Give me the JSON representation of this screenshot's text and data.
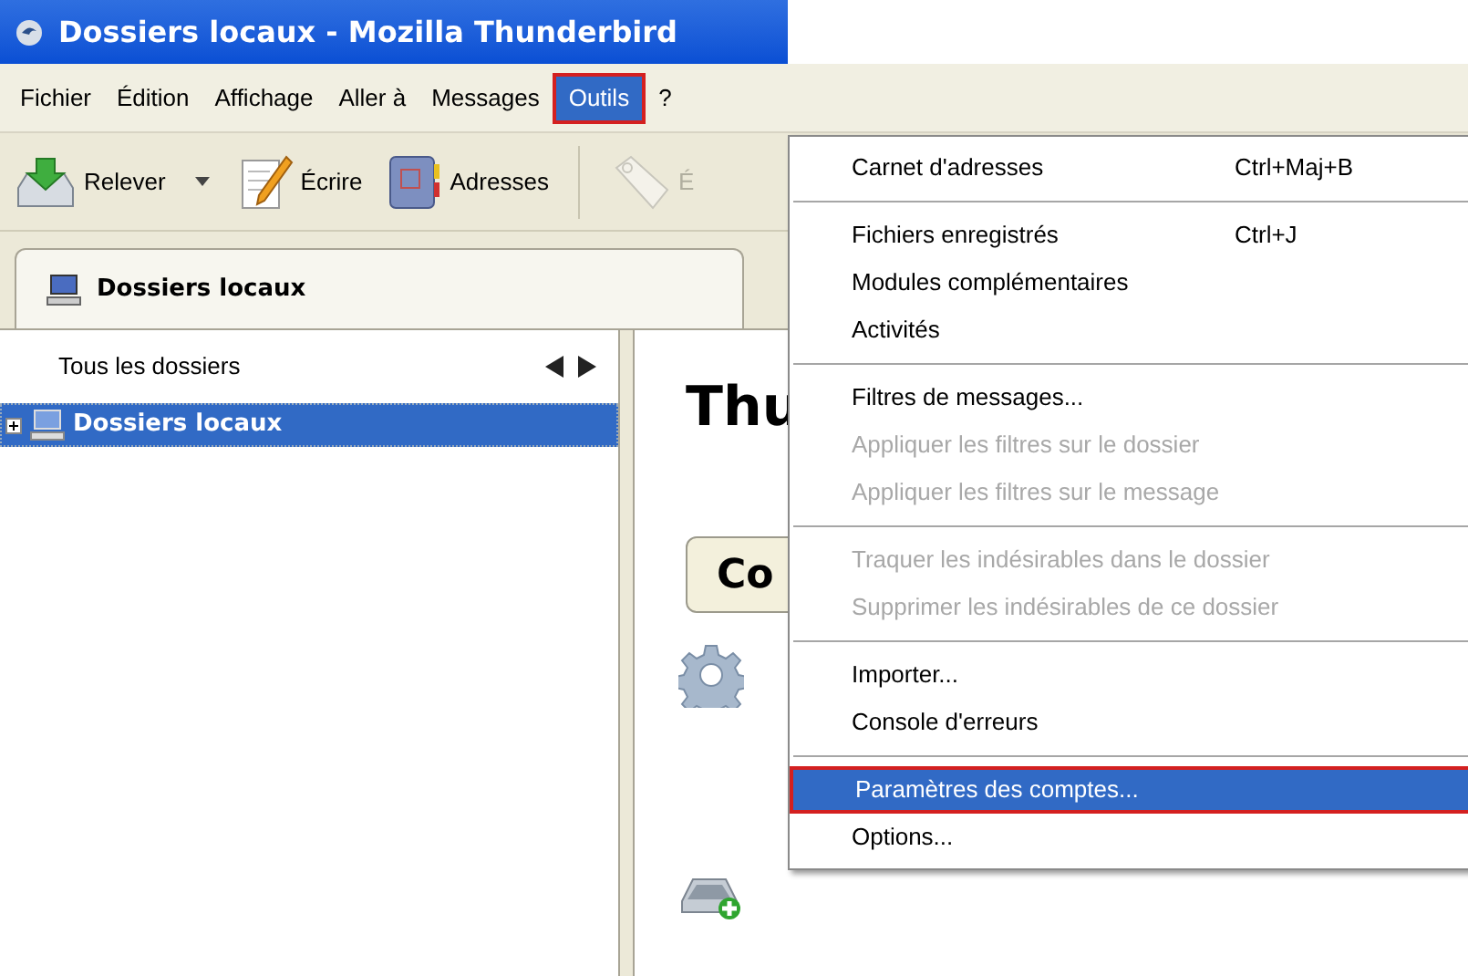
{
  "window": {
    "title": "Dossiers locaux - Mozilla Thunderbird"
  },
  "menubar": [
    {
      "label": "Fichier",
      "selected": false
    },
    {
      "label": "Édition",
      "selected": false
    },
    {
      "label": "Affichage",
      "selected": false
    },
    {
      "label": "Aller à",
      "selected": false
    },
    {
      "label": "Messages",
      "selected": false
    },
    {
      "label": "Outils",
      "selected": true
    },
    {
      "label": "?",
      "selected": false
    }
  ],
  "toolbar": [
    {
      "kind": "get",
      "label": "Relever",
      "dropdown": true,
      "disabled": false
    },
    {
      "kind": "write",
      "label": "Écrire",
      "dropdown": false,
      "disabled": false
    },
    {
      "kind": "book",
      "label": "Adresses",
      "dropdown": false,
      "disabled": false
    },
    {
      "kind": "tag",
      "label": "É",
      "dropdown": false,
      "disabled": true
    }
  ],
  "tabs": [
    {
      "label": "Dossiers locaux",
      "selected": true
    }
  ],
  "folder_pane": {
    "header": "Tous les dossiers",
    "items": [
      {
        "label": "Dossiers locaux",
        "selected": true,
        "expanded": false
      }
    ]
  },
  "content": {
    "heading": "Thu",
    "button": "Co"
  },
  "menu": [
    {
      "kind": "item",
      "label": "Carnet d'adresses",
      "shortcut": "Ctrl+Maj+B",
      "disabled": false,
      "selected": false
    },
    {
      "kind": "separator"
    },
    {
      "kind": "item",
      "label": "Fichiers enregistrés",
      "shortcut": "Ctrl+J",
      "disabled": false,
      "selected": false
    },
    {
      "kind": "item",
      "label": "Modules complémentaires",
      "disabled": false,
      "selected": false
    },
    {
      "kind": "item",
      "label": "Activités",
      "disabled": false,
      "selected": false
    },
    {
      "kind": "separator"
    },
    {
      "kind": "item",
      "label": "Filtres de messages...",
      "disabled": false,
      "selected": false
    },
    {
      "kind": "item",
      "label": "Appliquer les filtres sur le dossier",
      "disabled": true,
      "selected": false
    },
    {
      "kind": "item",
      "label": "Appliquer les filtres sur le message",
      "disabled": true,
      "selected": false
    },
    {
      "kind": "separator"
    },
    {
      "kind": "item",
      "label": "Traquer les indésirables dans le dossier",
      "disabled": true,
      "selected": false
    },
    {
      "kind": "item",
      "label": "Supprimer les indésirables de ce dossier",
      "disabled": true,
      "selected": false
    },
    {
      "kind": "separator"
    },
    {
      "kind": "item",
      "label": "Importer...",
      "disabled": false,
      "selected": false
    },
    {
      "kind": "item",
      "label": "Console d'erreurs",
      "disabled": false,
      "selected": false
    },
    {
      "kind": "separator"
    },
    {
      "kind": "item",
      "label": "Paramètres des comptes...",
      "disabled": false,
      "selected": true
    },
    {
      "kind": "item",
      "label": "Options...",
      "disabled": false,
      "selected": false
    }
  ]
}
